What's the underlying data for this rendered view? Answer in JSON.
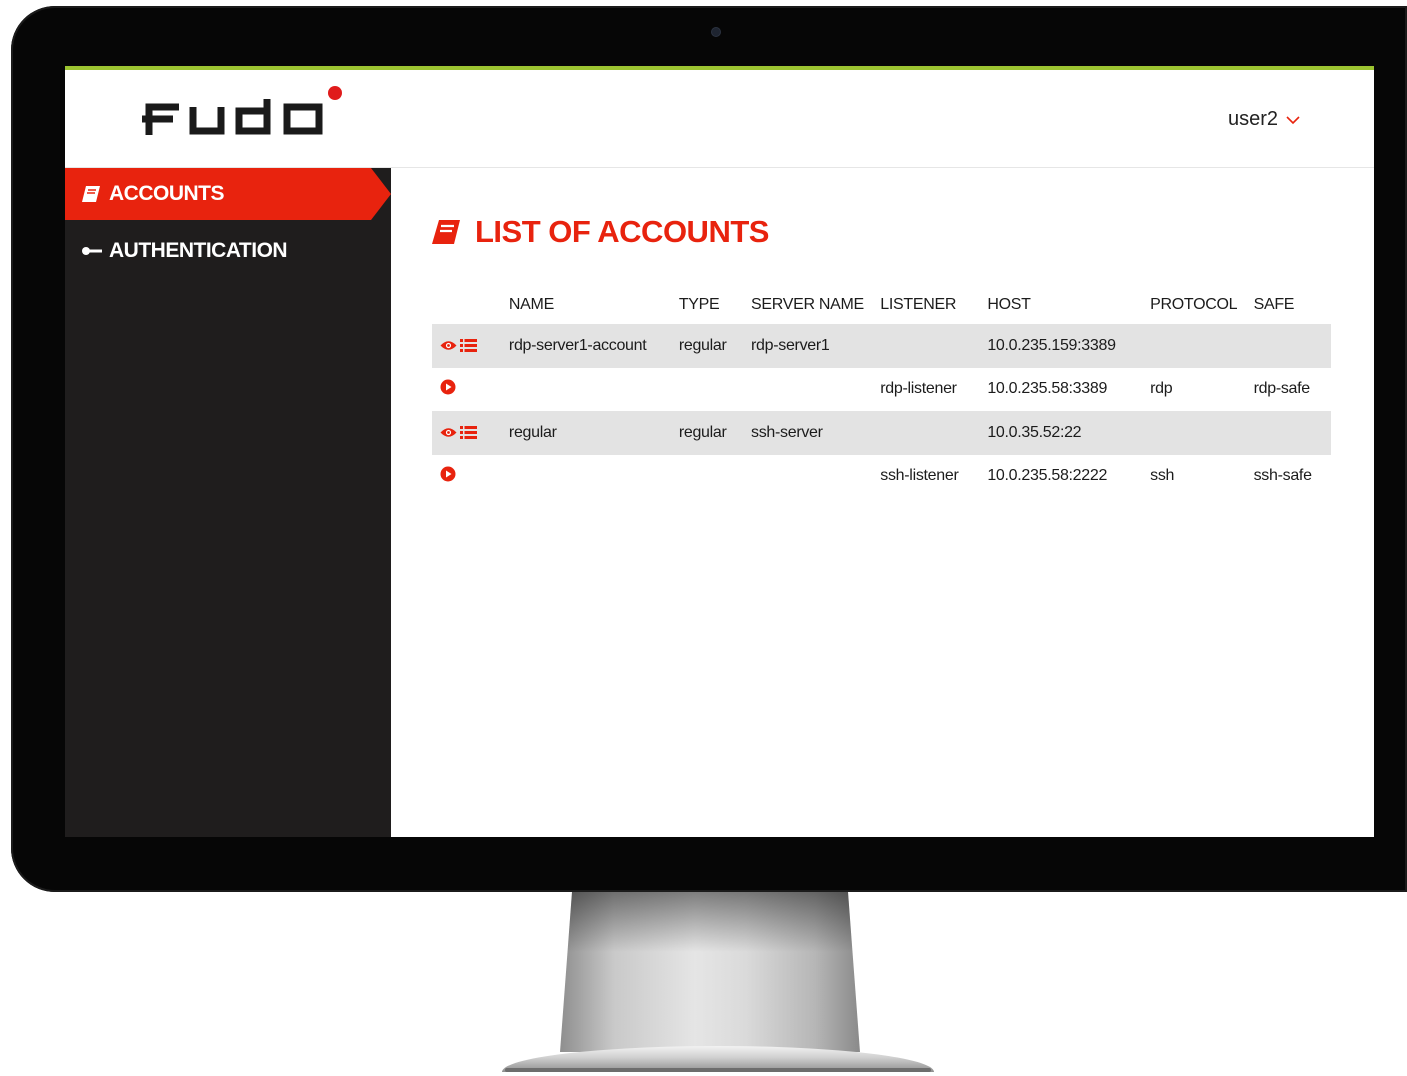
{
  "header": {
    "logo_text": "Fudo",
    "user": "user2",
    "colors": {
      "accent_line": "#9cc431",
      "brand_red": "#e8230e",
      "sidebar_bg": "#1f1d1d"
    }
  },
  "sidebar": {
    "items": [
      {
        "label": "ACCOUNTS",
        "icon": "book-icon",
        "active": true
      },
      {
        "label": "AUTHENTICATION",
        "icon": "key-icon",
        "active": false
      }
    ]
  },
  "main": {
    "title": "LIST OF ACCOUNTS",
    "title_icon": "book-icon",
    "table": {
      "columns": [
        "NAME",
        "TYPE",
        "SERVER NAME",
        "LISTENER",
        "HOST",
        "PROTOCOL",
        "SAFE"
      ],
      "rows": [
        {
          "kind": "account",
          "actions": [
            "eye-icon",
            "list-icon"
          ],
          "name": "rdp-server1-account",
          "type": "regular",
          "server_name": "rdp-server1",
          "listener": "",
          "host": "10.0.235.159:3389",
          "protocol": "",
          "safe": ""
        },
        {
          "kind": "listener",
          "actions": [
            "play-circle-icon"
          ],
          "name": "",
          "type": "",
          "server_name": "",
          "listener": "rdp-listener",
          "host": "10.0.235.58:3389",
          "protocol": "rdp",
          "safe": "rdp-safe"
        },
        {
          "kind": "account",
          "actions": [
            "eye-icon",
            "list-icon"
          ],
          "name": "regular",
          "type": "regular",
          "server_name": "ssh-server",
          "listener": "",
          "host": "10.0.35.52:22",
          "protocol": "",
          "safe": ""
        },
        {
          "kind": "listener",
          "actions": [
            "play-circle-icon"
          ],
          "name": "",
          "type": "",
          "server_name": "",
          "listener": "ssh-listener",
          "host": "10.0.235.58:2222",
          "protocol": "ssh",
          "safe": "ssh-safe"
        }
      ]
    }
  }
}
